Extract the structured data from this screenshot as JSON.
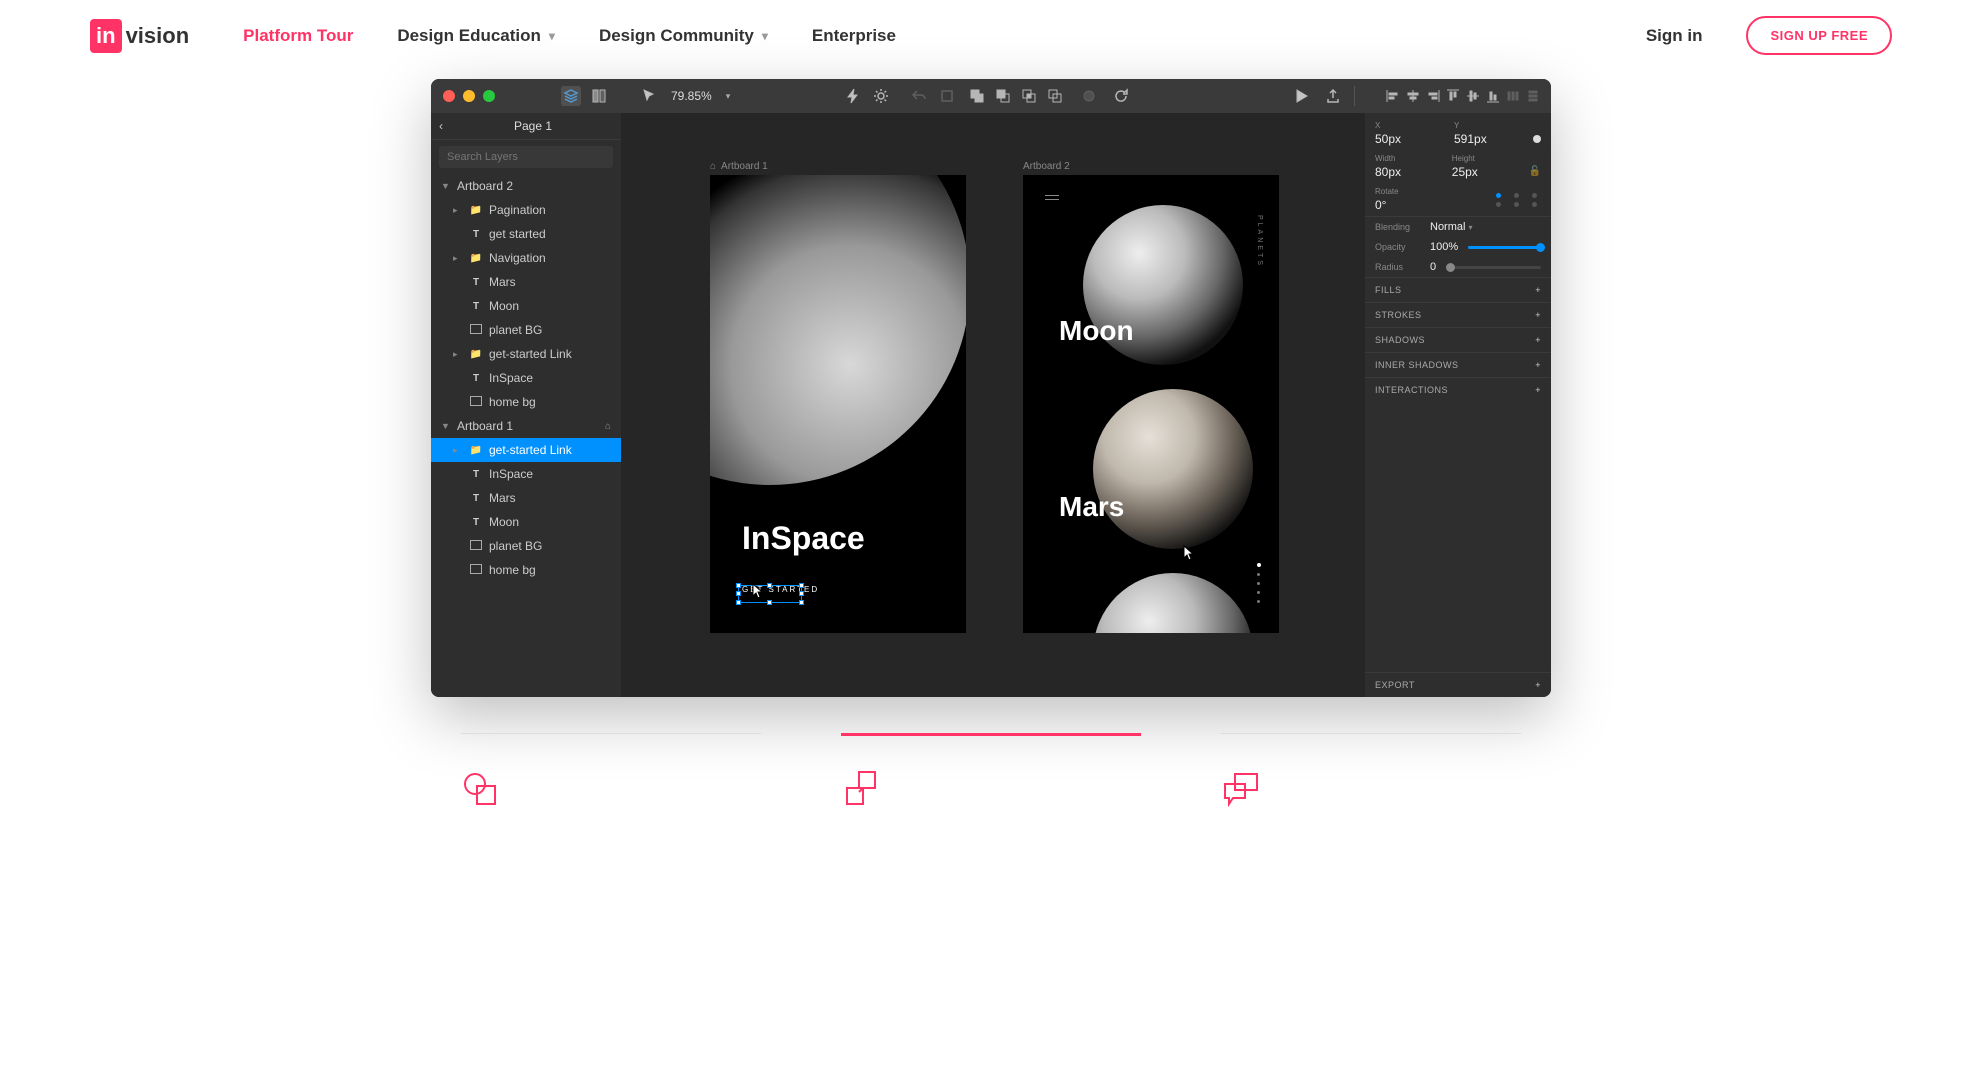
{
  "header": {
    "brand_prefix": "in",
    "brand_suffix": "vision",
    "nav": [
      {
        "label": "Platform Tour",
        "active": true
      },
      {
        "label": "Design Education",
        "dropdown": true
      },
      {
        "label": "Design Community",
        "dropdown": true
      },
      {
        "label": "Enterprise"
      }
    ],
    "signin": "Sign in",
    "signup": "SIGN UP FREE"
  },
  "app": {
    "zoom": "79.85%",
    "page_title": "Page 1",
    "search_placeholder": "Search Layers",
    "layers": {
      "artboard2": {
        "name": "Artboard 2",
        "items": [
          "Pagination",
          "get started",
          "Navigation",
          "Mars",
          "Moon",
          "planet BG",
          "get-started Link",
          "InSpace",
          "home bg"
        ]
      },
      "artboard1": {
        "name": "Artboard 1",
        "items": [
          "get-started Link",
          "InSpace",
          "Mars",
          "Moon",
          "planet BG",
          "home bg"
        ]
      }
    },
    "canvas": {
      "artboard1_label": "Artboard 1",
      "artboard2_label": "Artboard 2",
      "inspace": "InSpace",
      "get_started": "GET STARTED",
      "moon": "Moon",
      "mars": "Mars",
      "planets_side": "PLANETS"
    },
    "inspector": {
      "x_label": "X",
      "x_value": "50px",
      "y_label": "Y",
      "y_value": "591px",
      "w_label": "Width",
      "w_value": "80px",
      "h_label": "Height",
      "h_value": "25px",
      "rotate_label": "Rotate",
      "rotate_value": "0°",
      "blending_label": "Blending",
      "blending_value": "Normal",
      "opacity_label": "Opacity",
      "opacity_value": "100%",
      "radius_label": "Radius",
      "radius_value": "0",
      "sections": [
        "FILLS",
        "STROKES",
        "SHADOWS",
        "INNER SHADOWS",
        "INTERACTIONS"
      ],
      "export": "EXPORT"
    }
  }
}
